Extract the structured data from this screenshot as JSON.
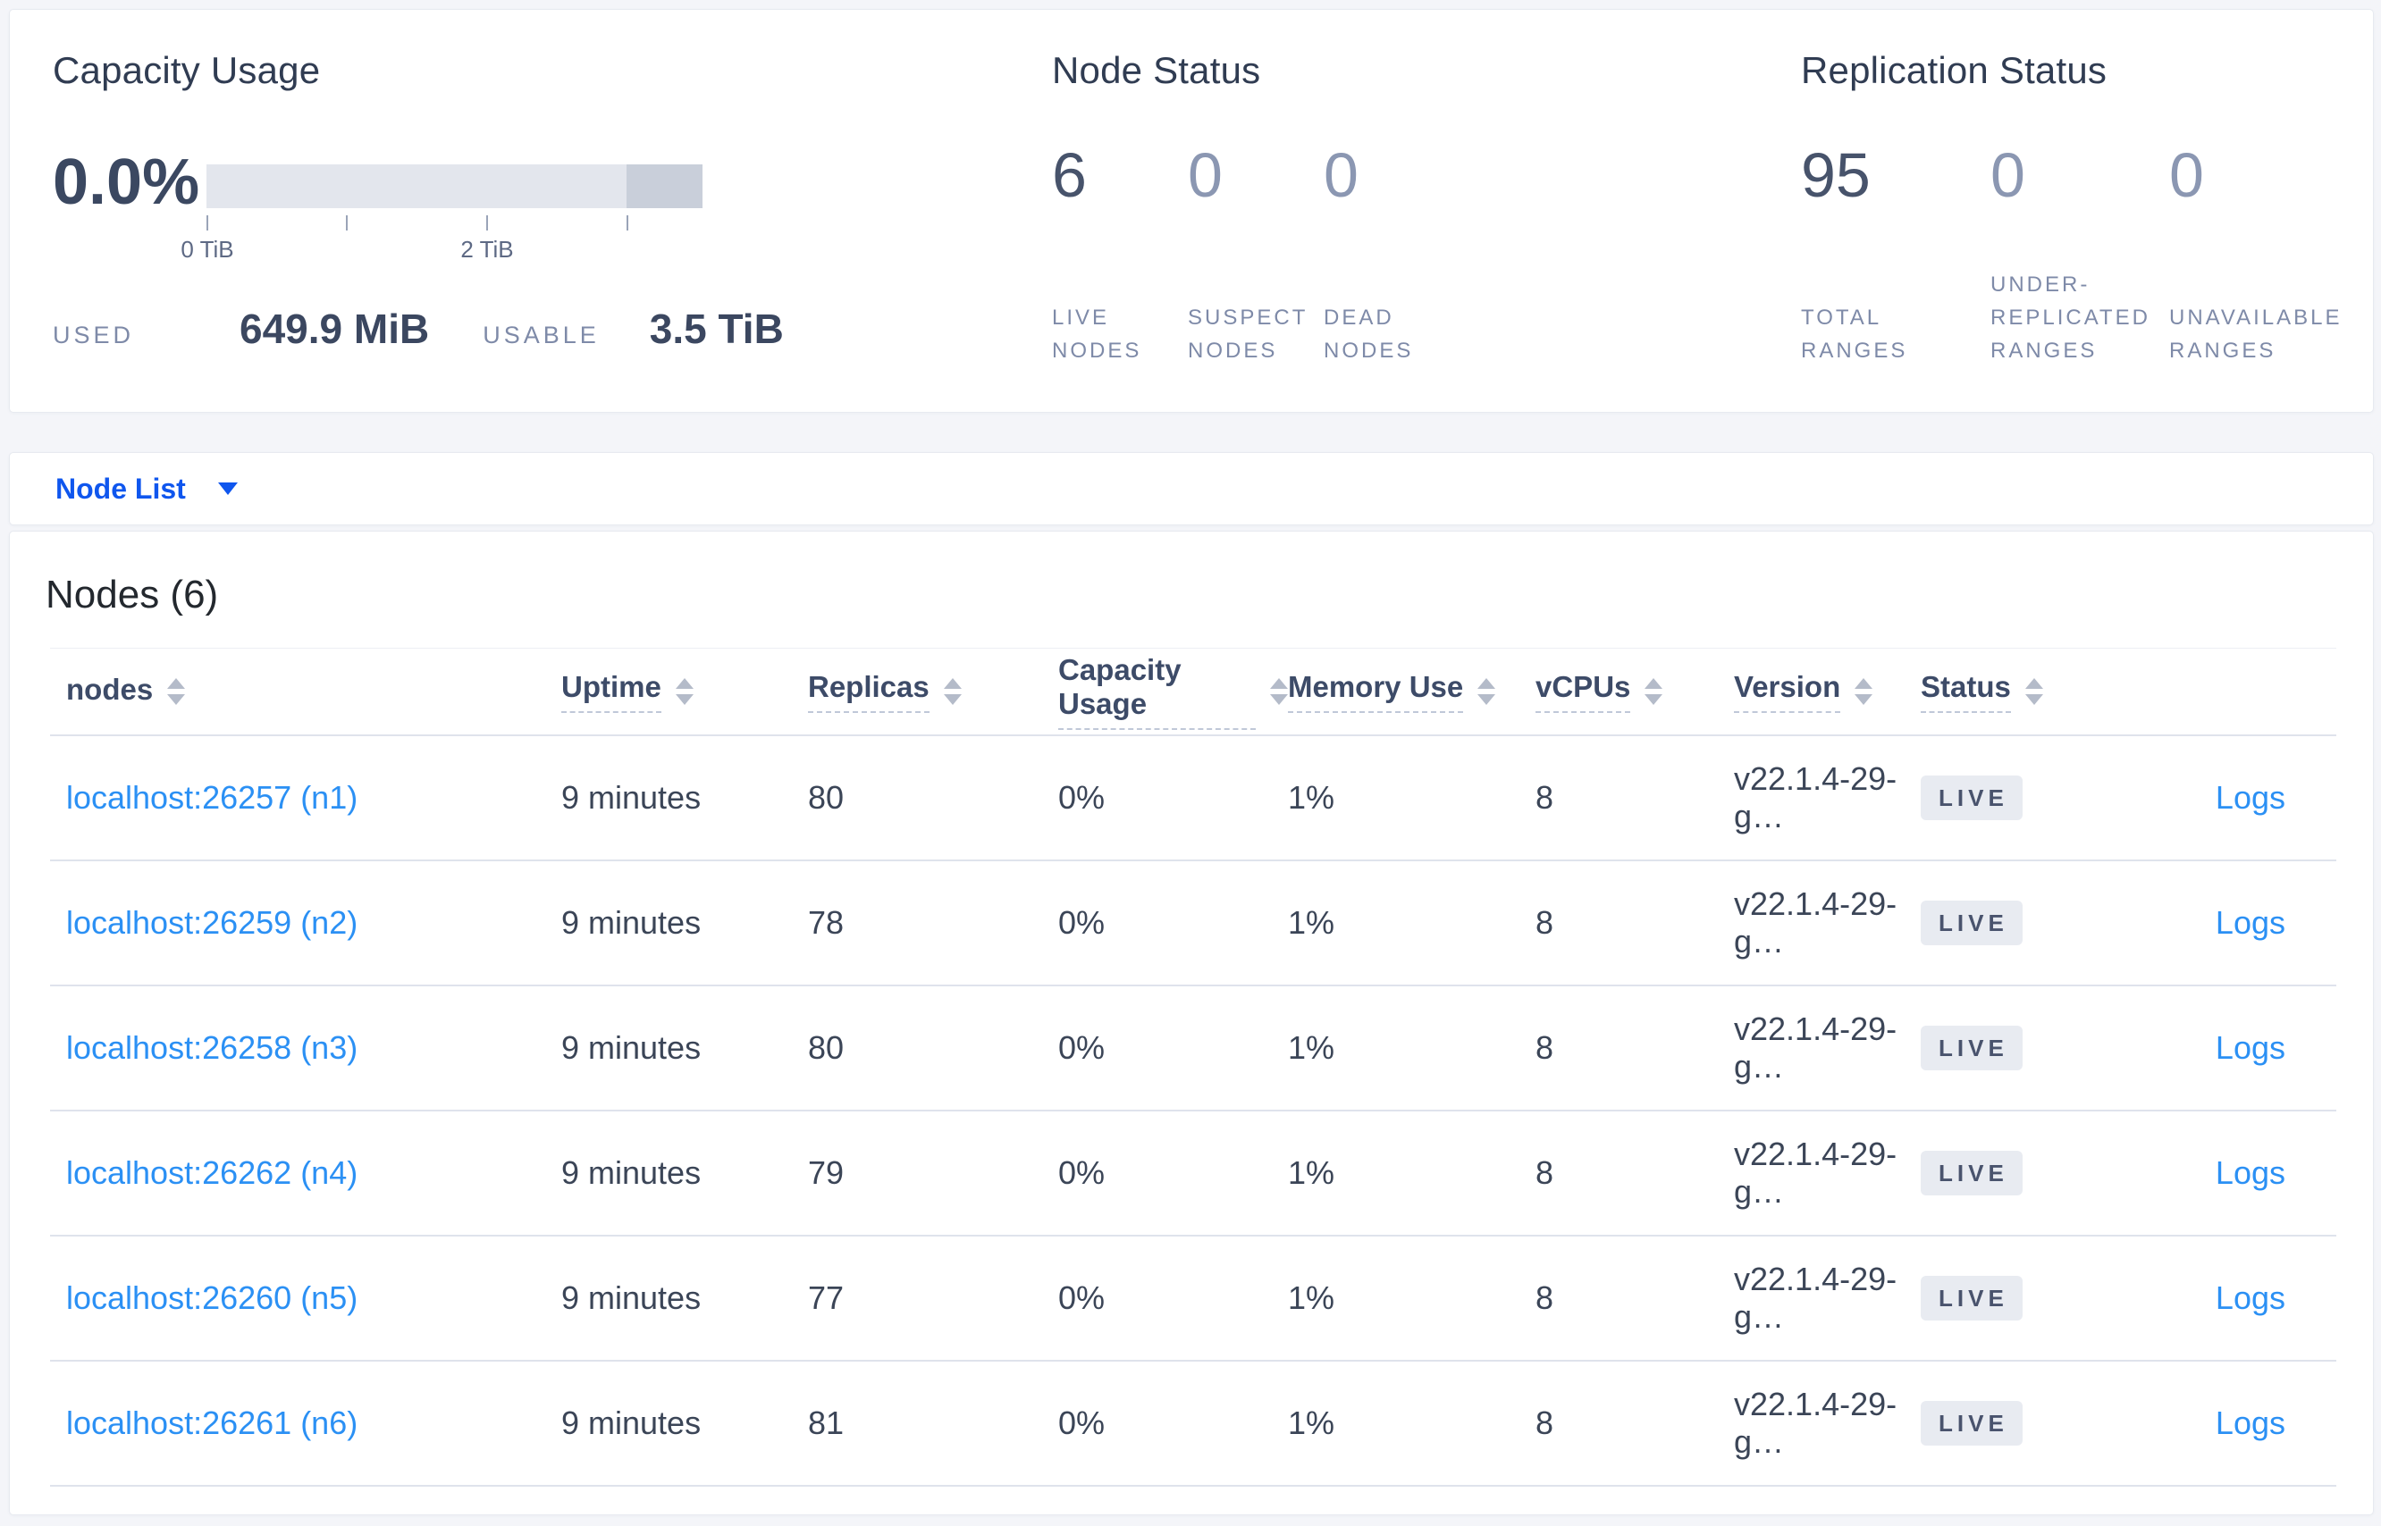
{
  "overview": {
    "capacity": {
      "title": "Capacity Usage",
      "percent": "0.0%",
      "used_label": "USED",
      "used_value": "649.9 MiB",
      "usable_label": "USABLE",
      "usable_value": "3.5 TiB",
      "bar": {
        "used_fraction": 0.0,
        "reserved_segment_start_fraction": 0.847,
        "tick_fractions": [
          0,
          0.281,
          0.564,
          0.847
        ],
        "tick_labels": [
          "0 TiB",
          "",
          "2 TiB",
          ""
        ],
        "track_color": "#e3e6ed",
        "segment_color": "#c9cfda"
      },
      "tick_label_0": "0 TiB",
      "tick_label_2": "2 TiB"
    },
    "node_status": {
      "title": "Node Status",
      "stats": [
        {
          "value": "6",
          "label": "LIVE\nNODES",
          "primary": true
        },
        {
          "value": "0",
          "label": "SUSPECT\nNODES",
          "primary": false
        },
        {
          "value": "0",
          "label": "DEAD\nNODES",
          "primary": false
        }
      ]
    },
    "replication_status": {
      "title": "Replication Status",
      "stats": [
        {
          "value": "95",
          "label": "TOTAL\nRANGES",
          "primary": true
        },
        {
          "value": "0",
          "label": "UNDER-\nREPLICATED\nRANGES",
          "primary": false
        },
        {
          "value": "0",
          "label": "UNAVAILABLE\nRANGES",
          "primary": false
        }
      ]
    }
  },
  "view_selector": {
    "label": "Node List"
  },
  "nodes_table": {
    "title": "Nodes (6)",
    "columns": [
      "nodes",
      "Uptime",
      "Replicas",
      "Capacity Usage",
      "Memory Use",
      "vCPUs",
      "Version",
      "Status"
    ],
    "rows": [
      {
        "node": "localhost:26257 (n1)",
        "uptime": "9 minutes",
        "replicas": "80",
        "capacity_usage": "0%",
        "memory_use": "1%",
        "vcpus": "8",
        "version": "v22.1.4-29-g…",
        "status": "LIVE",
        "logs": "Logs"
      },
      {
        "node": "localhost:26259 (n2)",
        "uptime": "9 minutes",
        "replicas": "78",
        "capacity_usage": "0%",
        "memory_use": "1%",
        "vcpus": "8",
        "version": "v22.1.4-29-g…",
        "status": "LIVE",
        "logs": "Logs"
      },
      {
        "node": "localhost:26258 (n3)",
        "uptime": "9 minutes",
        "replicas": "80",
        "capacity_usage": "0%",
        "memory_use": "1%",
        "vcpus": "8",
        "version": "v22.1.4-29-g…",
        "status": "LIVE",
        "logs": "Logs"
      },
      {
        "node": "localhost:26262 (n4)",
        "uptime": "9 minutes",
        "replicas": "79",
        "capacity_usage": "0%",
        "memory_use": "1%",
        "vcpus": "8",
        "version": "v22.1.4-29-g…",
        "status": "LIVE",
        "logs": "Logs"
      },
      {
        "node": "localhost:26260 (n5)",
        "uptime": "9 minutes",
        "replicas": "77",
        "capacity_usage": "0%",
        "memory_use": "1%",
        "vcpus": "8",
        "version": "v22.1.4-29-g…",
        "status": "LIVE",
        "logs": "Logs"
      },
      {
        "node": "localhost:26261 (n6)",
        "uptime": "9 minutes",
        "replicas": "81",
        "capacity_usage": "0%",
        "memory_use": "1%",
        "vcpus": "8",
        "version": "v22.1.4-29-g…",
        "status": "LIVE",
        "logs": "Logs"
      }
    ]
  },
  "colors": {
    "page_background": "#f4f5f9",
    "selector_blue": "#0f56ee",
    "link_blue": "#2b90f4",
    "live_badge_background": "#e8ebf1",
    "live_badge_text": "#49536d",
    "primary_stat": "#47536b",
    "muted_stat": "#8b97b2"
  }
}
